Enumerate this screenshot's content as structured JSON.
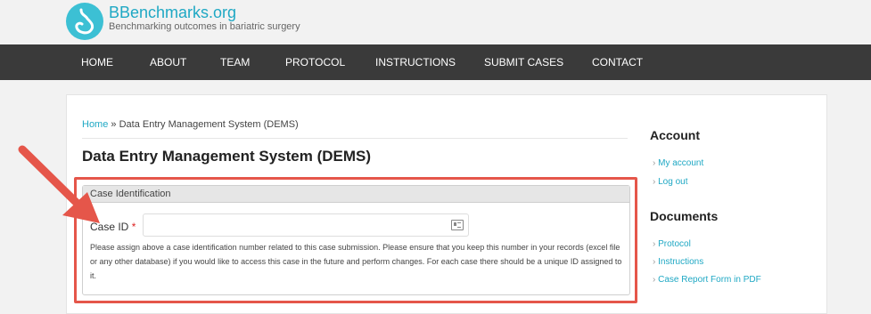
{
  "site": {
    "name": "BBenchmarks.org",
    "slogan": "Benchmarking outcomes in bariatric surgery"
  },
  "nav": [
    "HOME",
    "ABOUT",
    "TEAM",
    "PROTOCOL",
    "INSTRUCTIONS",
    "SUBMIT CASES",
    "CONTACT"
  ],
  "breadcrumb": {
    "home": "Home",
    "sep": " » ",
    "current": "Data Entry Management System (DEMS)"
  },
  "page_title": "Data Entry Management System (DEMS)",
  "form": {
    "legend": "Case Identification",
    "field_label": "Case ID",
    "required_mark": "*",
    "value": "",
    "description": "Please assign above a case identification number related to this case submission. Please ensure that you keep this number in your records (excel file or any other database) if you would like to access this case in the future and perform changes. For each case there should be a unique ID assigned to it."
  },
  "sidebar": {
    "account_heading": "Account",
    "account_links": [
      "My account",
      "Log out"
    ],
    "documents_heading": "Documents",
    "document_links": [
      "Protocol",
      "Instructions",
      "Case Report Form in PDF"
    ]
  },
  "colors": {
    "accent": "#1fa8c4",
    "nav_bg": "#3a3a3a",
    "highlight": "#e5564a"
  }
}
